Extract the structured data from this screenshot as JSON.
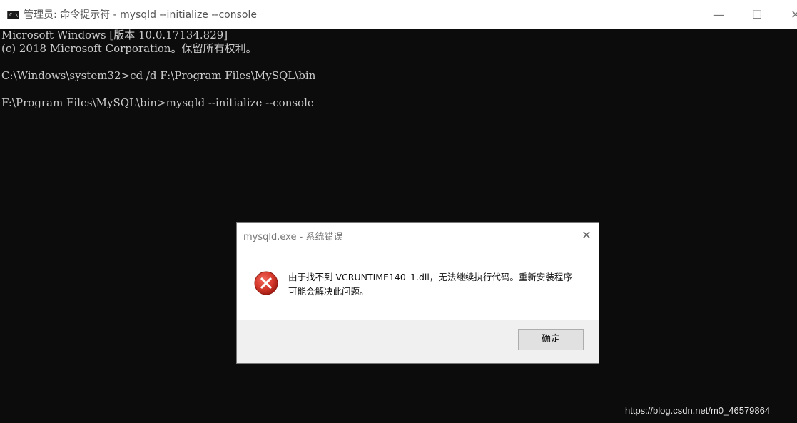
{
  "window": {
    "title": "管理员: 命令提示符 - mysqld  --initialize --console",
    "icon_label": "C:\\",
    "minimize_symbol": "—",
    "maximize_symbol": "☐",
    "close_symbol": "✕"
  },
  "console": {
    "lines": [
      "Microsoft Windows [版本 10.0.17134.829]",
      "(c) 2018 Microsoft Corporation。保留所有权利。",
      "",
      "C:\\Windows\\system32>cd /d F:\\Program Files\\MySQL\\bin",
      "",
      "F:\\Program Files\\MySQL\\bin>mysqld --initialize --console"
    ]
  },
  "dialog": {
    "title": "mysqld.exe - 系统错误",
    "close_symbol": "✕",
    "icon": "error-icon",
    "message": "由于找不到 VCRUNTIME140_1.dll，无法继续执行代码。重新安装程序可能会解决此问题。",
    "ok_label": "确定"
  },
  "watermark": "https://blog.csdn.net/m0_46579864",
  "colors": {
    "console_bg": "#0c0c0c",
    "console_text": "#cccccc",
    "error_red": "#c42b1c"
  }
}
